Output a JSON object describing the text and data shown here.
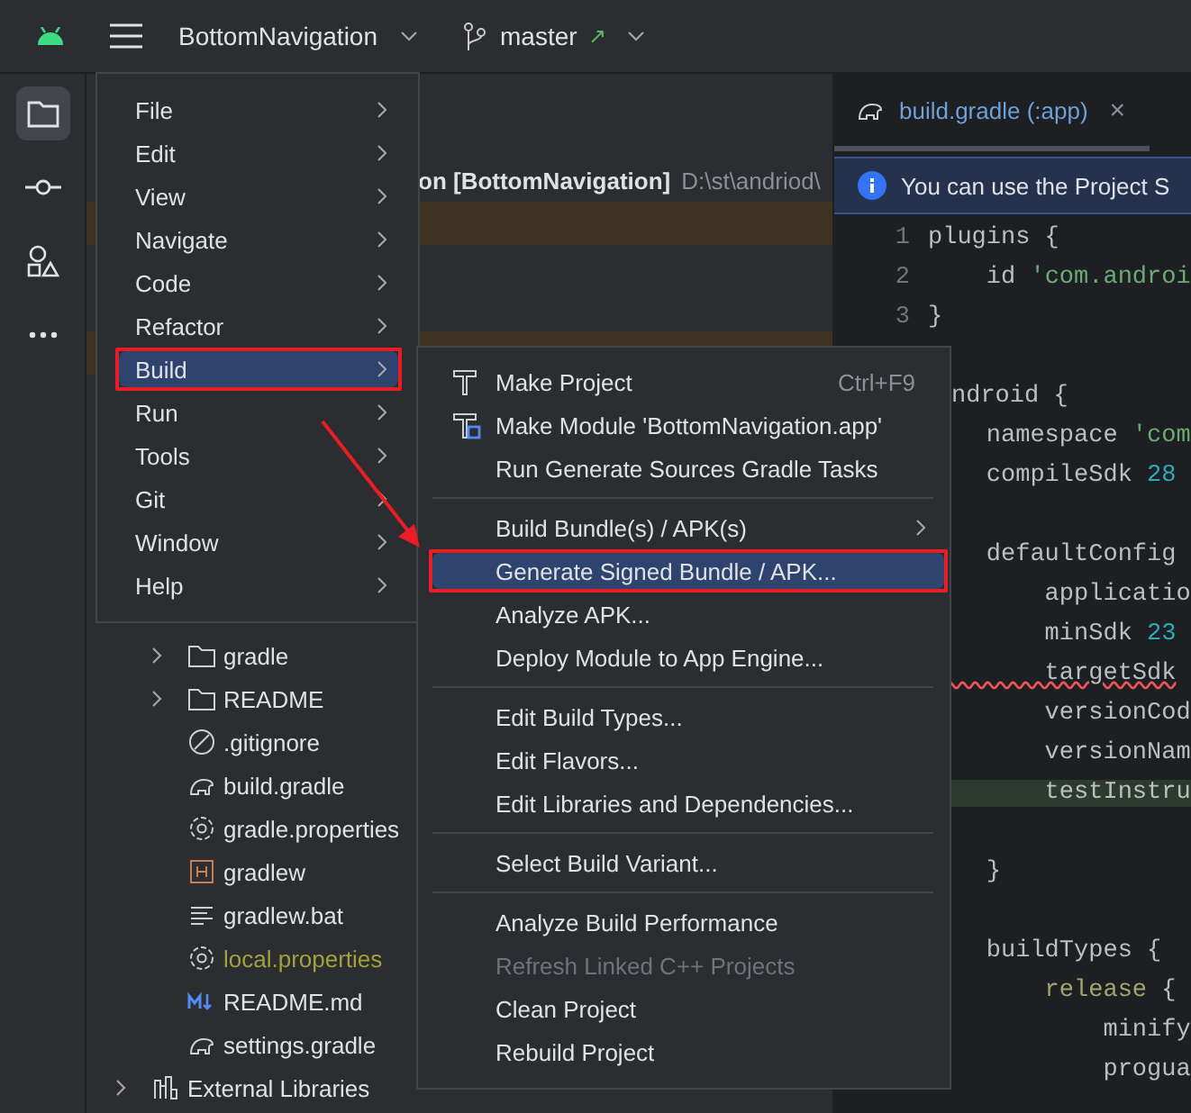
{
  "title_bar": {
    "project": "BottomNavigation",
    "branch": "master",
    "branch_arrow": "↗"
  },
  "tool_strip": [
    {
      "kind": "folder",
      "selected": true
    },
    {
      "kind": "commit",
      "selected": false
    },
    {
      "kind": "shapes",
      "selected": false
    },
    {
      "kind": "more",
      "selected": false
    }
  ],
  "project_panel": {
    "header": {
      "name": "on [BottomNavigation]",
      "path": "D:\\st\\andriod\\"
    },
    "items": [
      {
        "children": [
          {
            "label": "gradle",
            "kind": "folder",
            "expanded": false,
            "color": "#dfe1e5"
          },
          {
            "label": "README",
            "kind": "folder",
            "expanded": false,
            "color": "#dfe1e5"
          },
          {
            "label": ".gitignore",
            "kind": "ignore",
            "color": "#dfe1e5"
          },
          {
            "label": "build.gradle",
            "kind": "gradle",
            "color": "#dfe1e5"
          },
          {
            "label": "gradle.properties",
            "kind": "settings",
            "color": "#dfe1e5"
          },
          {
            "label": "gradlew",
            "kind": "shell",
            "color": "#dfe1e5"
          },
          {
            "label": "gradlew.bat",
            "kind": "text",
            "color": "#dfe1e5"
          },
          {
            "label": "local.properties",
            "kind": "settings",
            "color": "#a3a13b"
          },
          {
            "label": "README.md",
            "kind": "markdown",
            "color": "#dfe1e5"
          },
          {
            "label": "settings.gradle",
            "kind": "gradle",
            "color": "#dfe1e5"
          }
        ]
      },
      {
        "label": "External Libraries",
        "kind": "library",
        "expanded": false,
        "color": "#dfe1e5"
      }
    ]
  },
  "editor": {
    "tab": {
      "label": "build.gradle (:app)",
      "close": "×"
    },
    "banner": "You can use the Project S",
    "lines": [
      {
        "kind": "code",
        "number": "1",
        "tokens": [
          {
            "text": "plugins {",
            "kind": "plain"
          }
        ]
      },
      {
        "kind": "code",
        "number": "2",
        "tokens": [
          {
            "text": "    id ",
            "kind": "plain"
          },
          {
            "text": "'com.androi",
            "kind": "string"
          }
        ]
      },
      {
        "kind": "code",
        "number": "3",
        "tokens": [
          {
            "text": "}",
            "kind": "plain"
          }
        ]
      },
      {
        "kind": "blank"
      },
      {
        "kind": "cut",
        "tokens": [
          {
            "text": "ndroid {",
            "kind": "plain"
          }
        ]
      },
      {
        "kind": "code",
        "tokens": [
          {
            "text": "    namespace ",
            "kind": "plain"
          },
          {
            "text": "'com",
            "kind": "string"
          }
        ]
      },
      {
        "kind": "code",
        "tokens": [
          {
            "text": "    compileSdk ",
            "kind": "plain"
          },
          {
            "text": "28",
            "kind": "number"
          }
        ]
      },
      {
        "kind": "blank"
      },
      {
        "kind": "code",
        "tokens": [
          {
            "text": "    defaultConfig",
            "kind": "plain"
          }
        ]
      },
      {
        "kind": "code",
        "tokens": [
          {
            "text": "        applicatio",
            "kind": "plain"
          }
        ]
      },
      {
        "kind": "code",
        "tokens": [
          {
            "text": "        minSdk ",
            "kind": "plain"
          },
          {
            "text": "23",
            "kind": "number"
          }
        ]
      },
      {
        "kind": "code",
        "error": true,
        "tokens": [
          {
            "text": "        targetSdk",
            "kind": "plain"
          }
        ]
      },
      {
        "kind": "code",
        "tokens": [
          {
            "text": "        versionCod",
            "kind": "plain"
          }
        ]
      },
      {
        "kind": "code",
        "tokens": [
          {
            "text": "        versionNam",
            "kind": "plain"
          }
        ]
      },
      {
        "kind": "code",
        "highlighted": true,
        "tokens": [
          {
            "text": "        testInstru",
            "kind": "plain"
          }
        ]
      },
      {
        "kind": "blank"
      },
      {
        "kind": "code",
        "tokens": [
          {
            "text": "    }",
            "kind": "plain"
          }
        ]
      },
      {
        "kind": "blank"
      },
      {
        "kind": "code",
        "tokens": [
          {
            "text": "    buildTypes {",
            "kind": "plain"
          }
        ]
      },
      {
        "kind": "code",
        "tokens": [
          {
            "text": "        release",
            "kind": "dsl"
          },
          {
            "text": " {",
            "kind": "plain"
          }
        ]
      },
      {
        "kind": "code",
        "tokens": [
          {
            "text": "            minify",
            "kind": "plain"
          }
        ]
      },
      {
        "kind": "code",
        "tokens": [
          {
            "text": "            progua",
            "kind": "plain"
          }
        ]
      }
    ]
  },
  "main_menu": [
    {
      "label": "File",
      "selected": false,
      "submenu": true
    },
    {
      "label": "Edit",
      "selected": false,
      "submenu": true
    },
    {
      "label": "View",
      "selected": false,
      "submenu": true
    },
    {
      "label": "Navigate",
      "selected": false,
      "submenu": true
    },
    {
      "label": "Code",
      "selected": false,
      "submenu": true
    },
    {
      "label": "Refactor",
      "selected": false,
      "submenu": true
    },
    {
      "label": "Build",
      "selected": true,
      "submenu": true
    },
    {
      "label": "Run",
      "selected": false,
      "submenu": true
    },
    {
      "label": "Tools",
      "selected": false,
      "submenu": true
    },
    {
      "label": "Git",
      "selected": false,
      "submenu": true
    },
    {
      "label": "Window",
      "selected": false,
      "submenu": true
    },
    {
      "label": "Help",
      "selected": false,
      "submenu": true
    }
  ],
  "build_menu": [
    [
      {
        "label": "Make Project",
        "kind": "hammer",
        "shortcut": "Ctrl+F9",
        "selected": false,
        "disabled": false
      },
      {
        "label": "Make Module 'BottomNavigation.app'",
        "kind": "module",
        "selected": false,
        "disabled": false
      },
      {
        "label": "Run Generate Sources Gradle Tasks",
        "selected": false,
        "disabled": false
      }
    ],
    [
      {
        "label": "Build Bundle(s) / APK(s)",
        "submenu": true,
        "selected": false,
        "disabled": false
      },
      {
        "label": "Generate Signed Bundle / APK...",
        "selected": true,
        "disabled": false
      },
      {
        "label": "Analyze APK...",
        "selected": false,
        "disabled": false
      },
      {
        "label": "Deploy Module to App Engine...",
        "selected": false,
        "disabled": false
      }
    ],
    [
      {
        "label": "Edit Build Types...",
        "selected": false,
        "disabled": false
      },
      {
        "label": "Edit Flavors...",
        "selected": false,
        "disabled": false
      },
      {
        "label": "Edit Libraries and Dependencies...",
        "selected": false,
        "disabled": false
      }
    ],
    [
      {
        "label": "Select Build Variant...",
        "selected": false,
        "disabled": false
      }
    ],
    [
      {
        "label": "Analyze Build Performance",
        "selected": false,
        "disabled": false
      },
      {
        "label": "Refresh Linked C++ Projects",
        "selected": false,
        "disabled": true
      },
      {
        "label": "Clean Project",
        "selected": false,
        "disabled": false
      },
      {
        "label": "Rebuild Project",
        "selected": false,
        "disabled": false
      }
    ]
  ]
}
